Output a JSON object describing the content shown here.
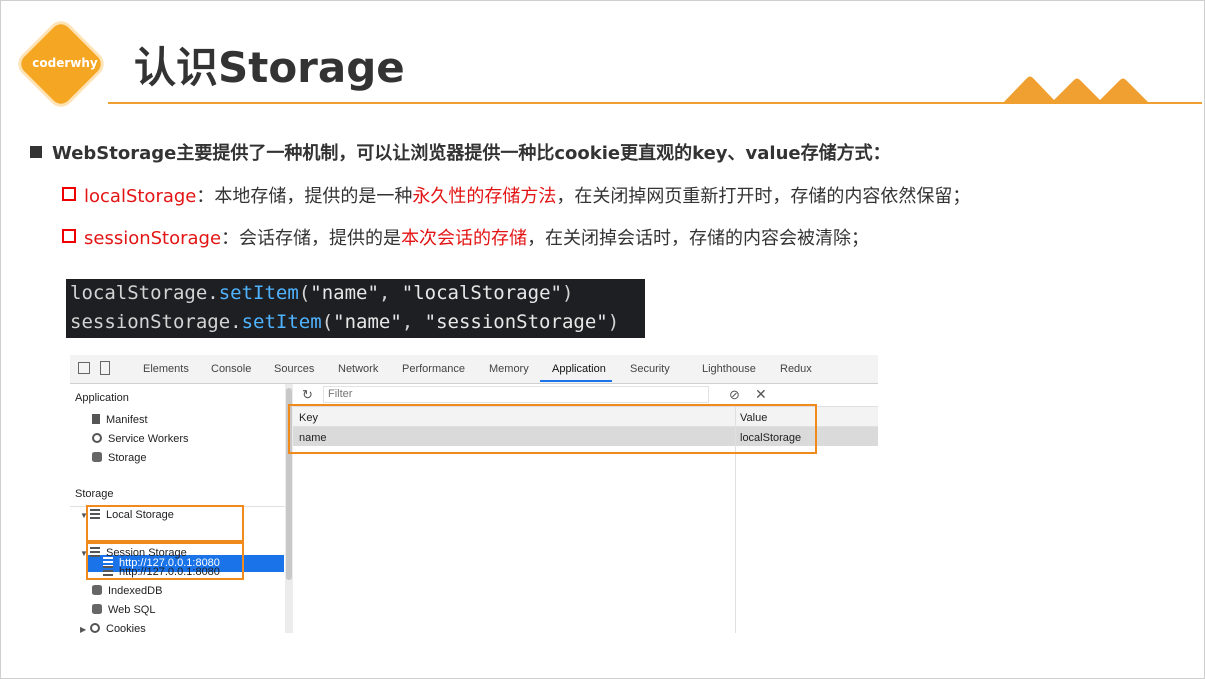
{
  "header": {
    "logo_text": "coderwhy",
    "title": "认识Storage"
  },
  "bullets": {
    "main": "WebStorage主要提供了一种机制，可以让浏览器提供一种比cookie更直观的key、value存储方式：",
    "local": {
      "name": "localStorage",
      "text_a": "：本地存储，提供的是一种",
      "highlight": "永久性的存储方法",
      "text_b": "，在关闭掉网页重新打开时，存储的内容依然保留；"
    },
    "session": {
      "name": "sessionStorage",
      "text_a": "：会话存储，提供的是",
      "highlight": "本次会话的存储",
      "text_b": "，在关闭掉会话时，存储的内容会被清除；"
    }
  },
  "code": {
    "line1": {
      "obj": "localStorage",
      "dot": ".",
      "fn": "setItem",
      "open": "(",
      "arg1": "\"name\"",
      "comma": ", ",
      "arg2": "\"localStorage\"",
      "close": ")"
    },
    "line2": {
      "obj": "sessionStorage",
      "dot": ".",
      "fn": "setItem",
      "open": "(",
      "arg1": "\"name\"",
      "comma": ", ",
      "arg2": "\"sessionStorage\"",
      "close": ")"
    }
  },
  "devtools": {
    "tabs": [
      "Elements",
      "Console",
      "Sources",
      "Network",
      "Performance",
      "Memory",
      "Application",
      "Security",
      "Lighthouse",
      "Redux"
    ],
    "active_tab": "Application",
    "sidebar": {
      "application_heading": "Application",
      "application_items": [
        "Manifest",
        "Service Workers",
        "Storage"
      ],
      "storage_heading": "Storage",
      "local_storage": "Local Storage",
      "local_origin": "http://127.0.0.1:8080",
      "session_storage": "Session Storage",
      "session_origin": "http://127.0.0.1:8080",
      "indexeddb": "IndexedDB",
      "websql": "Web SQL",
      "cookies": "Cookies"
    },
    "filter_placeholder": "Filter",
    "table": {
      "headers": [
        "Key",
        "Value"
      ],
      "rows": [
        {
          "key": "name",
          "value": "localStorage"
        }
      ]
    }
  },
  "colors": {
    "accent": "#f5a623",
    "highlight_red": "#e31414",
    "selection_blue": "#1a73e8",
    "box_orange": "#f08a1c"
  }
}
